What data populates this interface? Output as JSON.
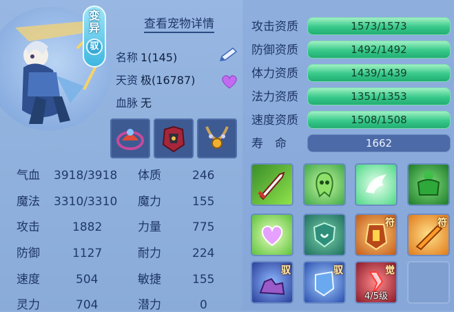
{
  "badge": {
    "variant": "变异",
    "tag": "驭"
  },
  "detail_link": "查看宠物详情",
  "info": [
    {
      "key": "名称",
      "value": "1(145)"
    },
    {
      "key": "天资",
      "value": "极(16787)"
    },
    {
      "key": "血脉",
      "value": "无"
    }
  ],
  "stats": [
    {
      "key": "气血",
      "value": "3918/3918",
      "key2": "体质",
      "value2": "246"
    },
    {
      "key": "魔法",
      "value": "3310/3310",
      "key2": "魔力",
      "value2": "155"
    },
    {
      "key": "攻击",
      "value": "1882",
      "key2": "力量",
      "value2": "775"
    },
    {
      "key": "防御",
      "value": "1127",
      "key2": "耐力",
      "value2": "224"
    },
    {
      "key": "速度",
      "value": "504",
      "key2": "敏捷",
      "value2": "155"
    },
    {
      "key": "灵力",
      "value": "704",
      "key2": "潜力",
      "value2": "0"
    }
  ],
  "aptitudes": [
    {
      "label": "攻击资质",
      "value": "1573/1573"
    },
    {
      "label": "防御资质",
      "value": "1492/1492"
    },
    {
      "label": "体力资质",
      "value": "1439/1439"
    },
    {
      "label": "法力资质",
      "value": "1351/1353"
    },
    {
      "label": "速度资质",
      "value": "1508/1508"
    }
  ],
  "life": {
    "label": "寿　命",
    "value": "1662"
  },
  "skills": [
    {
      "icon": "sword-skill-icon",
      "tag": ""
    },
    {
      "icon": "ghost-skill-icon",
      "tag": ""
    },
    {
      "icon": "wings-skill-icon",
      "tag": ""
    },
    {
      "icon": "giant-skill-icon",
      "tag": ""
    },
    {
      "icon": "heart-skill-icon",
      "tag": ""
    },
    {
      "icon": "shield-skill-icon",
      "tag": ""
    },
    {
      "icon": "armor-skill-icon",
      "tag": "符"
    },
    {
      "icon": "blade-skill-icon",
      "tag": "符"
    },
    {
      "icon": "rock-skill-icon",
      "tag": "驭"
    },
    {
      "icon": "ward-skill-icon",
      "tag": "驭"
    },
    {
      "icon": "awaken-skill-icon",
      "tag": "觉",
      "level": "4/5级"
    },
    {
      "icon": "empty-slot",
      "tag": ""
    }
  ],
  "colors": {
    "aptitude_bar": "#38c98b",
    "life_bar": "#4c6aa7",
    "panel": "#8fb0dc"
  }
}
